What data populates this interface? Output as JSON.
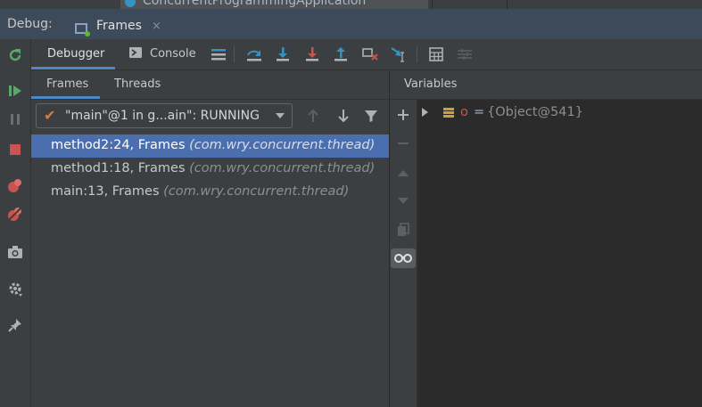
{
  "top": {
    "config_name": "ConcurrentProgrammingApplication"
  },
  "title_bar": {
    "debug_label": "Debug:",
    "tab_label": "Frames",
    "close_symbol": "×"
  },
  "toolbar": {
    "debugger_label": "Debugger",
    "console_label": "Console"
  },
  "frames_panel": {
    "tabs": [
      "Frames",
      "Threads"
    ],
    "thread": "\"main\"@1 in g...ain\": RUNNING",
    "frames": [
      {
        "method": "method2:24, Frames",
        "package": "(com.wry.concurrent.thread)",
        "selected": true
      },
      {
        "method": "method1:18, Frames",
        "package": "(com.wry.concurrent.thread)",
        "selected": false
      },
      {
        "method": "main:13, Frames",
        "package": "(com.wry.concurrent.thread)",
        "selected": false
      }
    ]
  },
  "variables": {
    "header": "Variables",
    "items": [
      {
        "name": "o",
        "equals": "=",
        "value": "{Object@541}"
      }
    ]
  },
  "colors": {
    "selection": "#4b6eaf",
    "accent": "#4a88c7",
    "resume_green": "#59a869",
    "stop_red": "#c75450",
    "check_orange": "#e07a3c",
    "field_icon": "#c9a23a",
    "var_name": "#d25252"
  }
}
